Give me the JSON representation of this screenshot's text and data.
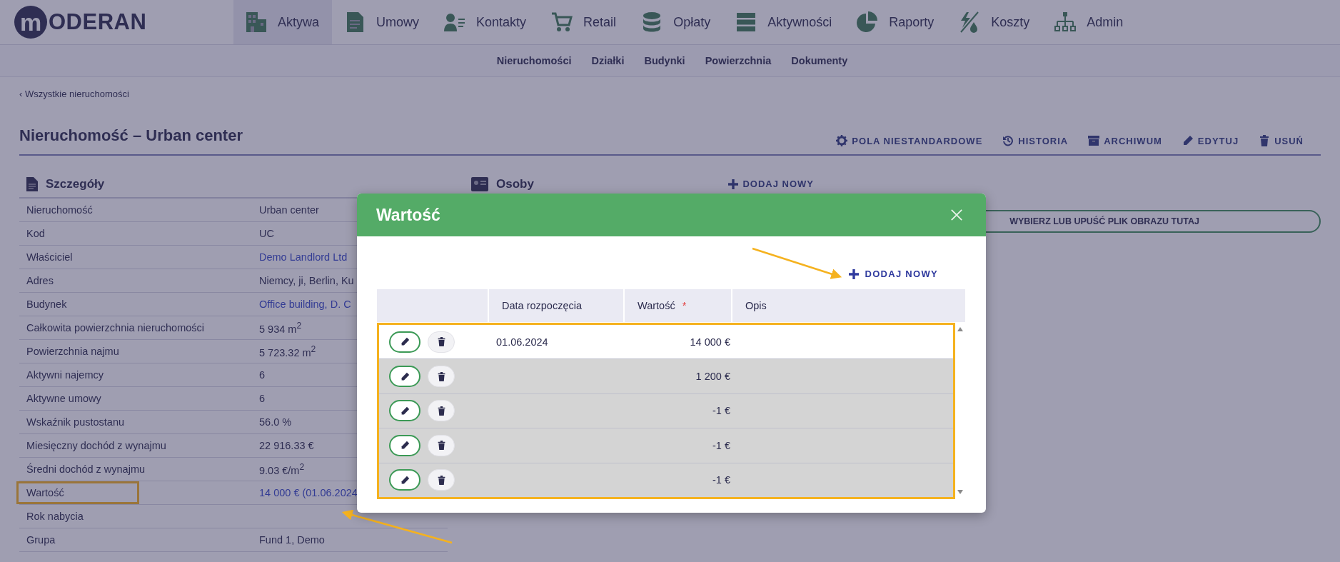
{
  "brand": {
    "logo_letter": "m",
    "name": "ODERAN"
  },
  "nav": [
    {
      "label": "Aktywa",
      "selected": true
    },
    {
      "label": "Umowy",
      "selected": false
    },
    {
      "label": "Kontakty",
      "selected": false
    },
    {
      "label": "Retail",
      "selected": false
    },
    {
      "label": "Opłaty",
      "selected": false
    },
    {
      "label": "Aktywności",
      "selected": false
    },
    {
      "label": "Raporty",
      "selected": false
    },
    {
      "label": "Koszty",
      "selected": false
    },
    {
      "label": "Admin",
      "selected": false
    }
  ],
  "subnav": [
    "Nieruchomości",
    "Działki",
    "Budynki",
    "Powierzchnia",
    "Dokumenty"
  ],
  "breadcrumb": {
    "chevron": "‹",
    "label": "Wszystkie nieruchomości"
  },
  "title": "Nieruchomość – Urban center",
  "actions": [
    "POLA NIESTANDARDOWE",
    "HISTORIA",
    "ARCHIWUM",
    "EDYTUJ",
    "USUŃ"
  ],
  "details": {
    "title": "Szczegóły",
    "rows": [
      {
        "label": "Nieruchomość",
        "value": "Urban center",
        "link": false,
        "highlighted": false
      },
      {
        "label": "Kod",
        "value": "UC",
        "link": false,
        "highlighted": false
      },
      {
        "label": "Właściciel",
        "value": "Demo Landlord Ltd",
        "link": true,
        "highlighted": false
      },
      {
        "label": "Adres",
        "value": "Niemcy, ji, Berlin, Ku",
        "link": false,
        "highlighted": false
      },
      {
        "label": "Budynek",
        "value": "Office building, D. C",
        "link": true,
        "highlighted": false
      },
      {
        "label": "Całkowita powierzchnia nieruchomości",
        "value": "5 934 m$^{2}$",
        "link": false,
        "highlighted": false
      },
      {
        "label": "Powierzchnia najmu",
        "value": "5 723.32 m$^{2}$",
        "link": false,
        "highlighted": false
      },
      {
        "label": "Aktywni najemcy",
        "value": "6",
        "link": false,
        "highlighted": false
      },
      {
        "label": "Aktywne umowy",
        "value": "6",
        "link": false,
        "highlighted": false
      },
      {
        "label": "Wskaźnik pustostanu",
        "value": "56.0 %",
        "link": false,
        "highlighted": false
      },
      {
        "label": "Miesięczny dochód z wynajmu",
        "value": "22 916.33 €",
        "link": false,
        "highlighted": false
      },
      {
        "label": "Średni dochód z wynajmu",
        "value": "9.03 €/m$^{2}$",
        "link": false,
        "highlighted": false
      },
      {
        "label": "Wartość",
        "value": "14 000 € (01.06.2024",
        "link": true,
        "highlighted": true
      },
      {
        "label": "Rok nabycia",
        "highlighted": false
      },
      {
        "label": "Grupa",
        "value": "Fund 1, Demo",
        "link": false,
        "highlighted": false
      }
    ]
  },
  "people": {
    "title": "Osoby",
    "add_label": "DODAJ NOWY"
  },
  "image_upload": {
    "label": "WYBIERZ LUB UPUŚĆ PLIK OBRAZU TUTAJ"
  },
  "modal": {
    "title": "Wartość",
    "add_label": "DODAJ NOWY",
    "columns": [
      {
        "label": "Data rozpoczęcia"
      },
      {
        "label": "Wartość",
        "required_mark": "*"
      },
      {
        "label": "Opis"
      }
    ],
    "rows": [
      {
        "start_date": "01.06.2024",
        "value": "14 000 €",
        "selected": true
      },
      {
        "start_date": "",
        "value": "1 200 €",
        "selected": false
      },
      {
        "start_date": "",
        "value": "-1 €",
        "selected": false
      },
      {
        "start_date": "",
        "value": "-1 €",
        "selected": false
      },
      {
        "start_date": "",
        "value": "-1 €",
        "selected": false
      }
    ]
  }
}
